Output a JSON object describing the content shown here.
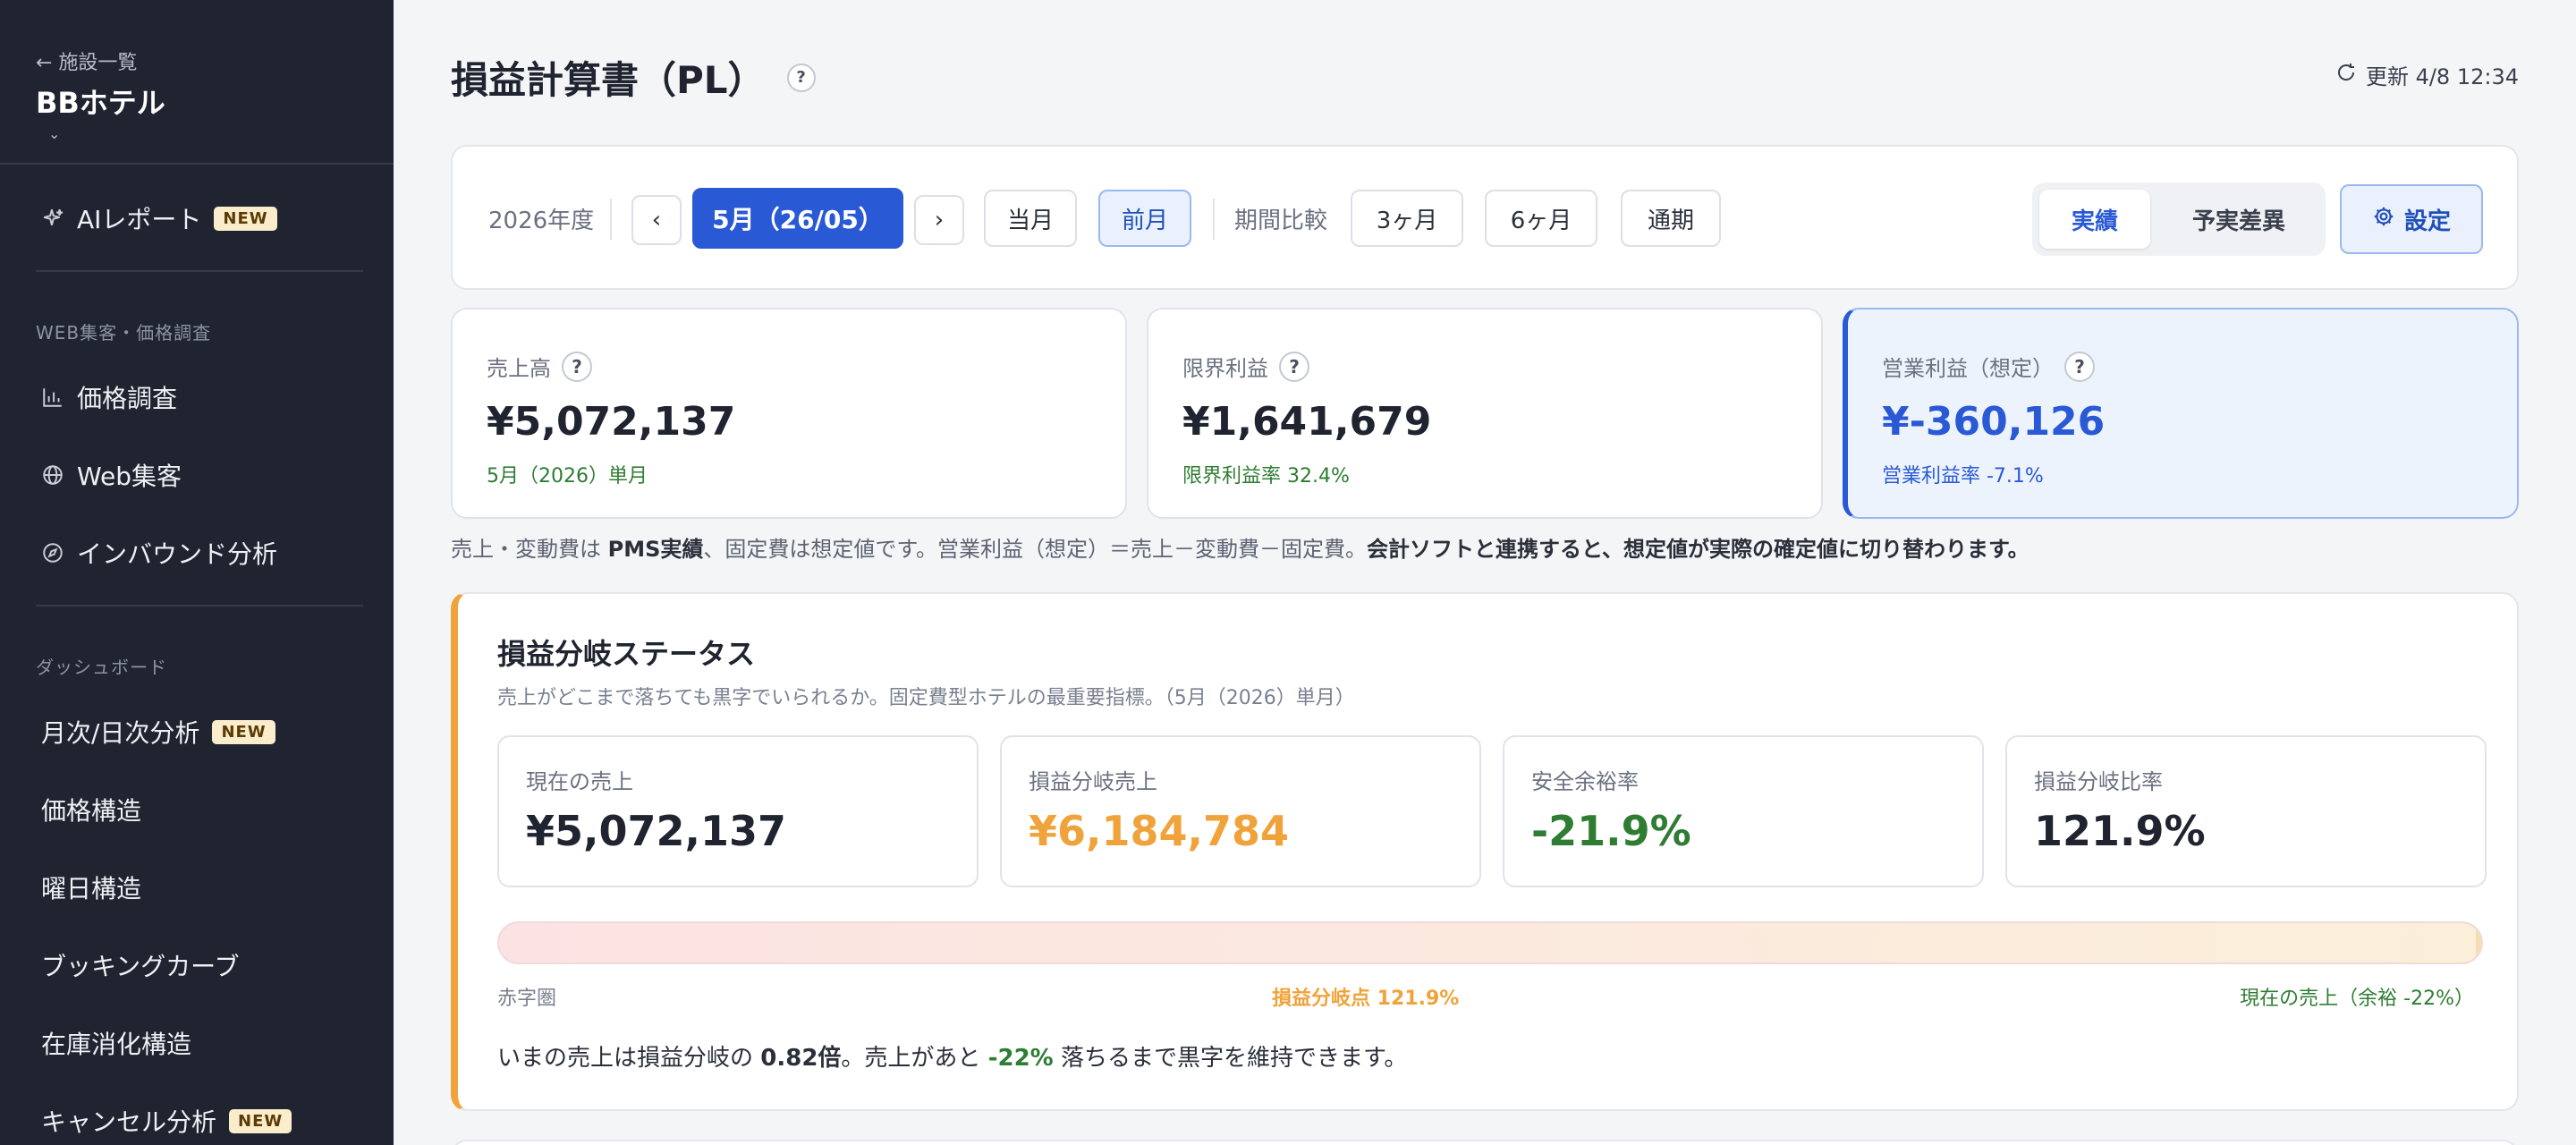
{
  "sidebar": {
    "back_label": "← 施設一覧",
    "property": "BBホテル",
    "ai_report": {
      "label": "AIレポート",
      "badge": "NEW"
    },
    "section_web": "WEB集客・価格調査",
    "web_items": [
      "価格調査",
      "Web集客",
      "インバウンド分析"
    ],
    "section_dashboard": "ダッシュボード",
    "dash_items": [
      {
        "label": "月次/日次分析",
        "badge": "NEW"
      },
      {
        "label": "価格構造",
        "badge": ""
      },
      {
        "label": "曜日構造",
        "badge": ""
      },
      {
        "label": "ブッキングカーブ",
        "badge": ""
      },
      {
        "label": "在庫消化構造",
        "badge": ""
      },
      {
        "label": "キャンセル分析",
        "badge": "NEW"
      }
    ]
  },
  "header": {
    "title": "損益計算書（PL）",
    "help": "?",
    "update": "更新 4/8 12:34"
  },
  "toolbar": {
    "fiscal_year": "2026年度",
    "prev": "‹",
    "period": "5月（26/05）",
    "next": "›",
    "this_month": "当月",
    "last_month": "前月",
    "compare_label": "期間比較",
    "ranges": [
      "3ヶ月",
      "6ヶ月",
      "通期"
    ],
    "mode_actual": "実績",
    "mode_diff": "予実差異",
    "settings": "設定"
  },
  "kpis": [
    {
      "label": "売上高",
      "value": "¥5,072,137",
      "sub": "5月（2026）単月"
    },
    {
      "label": "限界利益",
      "value": "¥1,641,679",
      "sub": "限界利益率 32.4%"
    },
    {
      "label": "営業利益（想定）",
      "value": "¥-360,126",
      "sub": "営業利益率 -7.1%"
    }
  ],
  "note": {
    "part1": "売上・変動費は ",
    "bold1": "PMS実績",
    "part2": "、固定費は想定値です。営業利益（想定）＝売上－変動費－固定費。",
    "bold2": "会計ソフトと連携すると、想定値が実際の確定値に切り替わります。"
  },
  "breakeven": {
    "title": "損益分岐ステータス",
    "desc": "売上がどこまで落ちても黒字でいられるか。固定費型ホテルの最重要指標。（5月（2026）単月）",
    "stats": [
      {
        "label": "現在の売上",
        "value": "¥5,072,137",
        "color": "#1f2430"
      },
      {
        "label": "損益分岐売上",
        "value": "¥6,184,784",
        "color": "#f0a33a"
      },
      {
        "label": "安全余裕率",
        "value": "-21.9%",
        "color": "#2e7d32"
      },
      {
        "label": "損益分岐比率",
        "value": "121.9%",
        "color": "#1f2430"
      }
    ],
    "bar_left": "赤字圏",
    "bar_mid": "損益分岐点 121.9%",
    "bar_right": "現在の売上（余裕 -22%）",
    "foot_a": "いまの売上は損益分岐の ",
    "foot_ratio": "0.82倍",
    "foot_b": "。売上があと ",
    "foot_pct": "-22%",
    "foot_c": " 落ちるまで黒字を維持できます。"
  },
  "colors": {
    "accent": "#2a59d6",
    "warning": "#f0a33a",
    "positive": "#2e7d32",
    "sidebar": "#1f2430"
  }
}
